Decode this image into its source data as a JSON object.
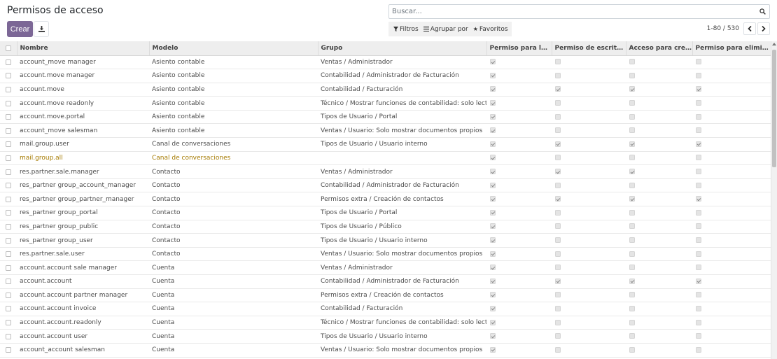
{
  "page": {
    "title": "Permisos de acceso"
  },
  "toolbar": {
    "create_label": "Crear"
  },
  "search": {
    "placeholder": "Buscar..."
  },
  "filters": {
    "filters_label": "Filtros",
    "groupby_label": "Agrupar por",
    "favorites_label": "Favoritos"
  },
  "pager": {
    "value": "1-80 / 530"
  },
  "colors": {
    "accent": "#7c6796",
    "warning_text": "#a57a00"
  },
  "icons": {
    "download": "download-icon",
    "search": "search-icon",
    "filter": "filter-icon",
    "groupby": "list-icon",
    "favorite": "star-icon",
    "prev": "chevron-left-icon",
    "next": "chevron-right-icon"
  },
  "table": {
    "columns": [
      "Nombre",
      "Modelo",
      "Grupo",
      "Permiso para leer",
      "Permiso de escritura…",
      "Acceso para crear",
      "Permiso para elimina…"
    ],
    "rows": [
      {
        "name": "account_move manager",
        "model": "Asiento contable",
        "group": "Ventas / Administrador",
        "read": true,
        "write": false,
        "create": false,
        "unlink": false
      },
      {
        "name": "account.move manager",
        "model": "Asiento contable",
        "group": "Contabilidad / Administrador de Facturación",
        "read": true,
        "write": false,
        "create": false,
        "unlink": false
      },
      {
        "name": "account.move",
        "model": "Asiento contable",
        "group": "Contabilidad / Facturación",
        "read": true,
        "write": true,
        "create": true,
        "unlink": true
      },
      {
        "name": "account.move readonly",
        "model": "Asiento contable",
        "group": "Técnico / Mostrar funciones de contabilidad: solo lectura",
        "read": true,
        "write": false,
        "create": false,
        "unlink": false
      },
      {
        "name": "account.move.portal",
        "model": "Asiento contable",
        "group": "Tipos de Usuario / Portal",
        "read": true,
        "write": false,
        "create": false,
        "unlink": false
      },
      {
        "name": "account_move salesman",
        "model": "Asiento contable",
        "group": "Ventas / Usuario: Solo mostrar documentos propios",
        "read": true,
        "write": false,
        "create": false,
        "unlink": false
      },
      {
        "name": "mail.group.user",
        "model": "Canal de conversaciones",
        "group": "Tipos de Usuario / Usuario interno",
        "read": true,
        "write": true,
        "create": true,
        "unlink": true
      },
      {
        "name": "mail.group.all",
        "model": "Canal de conversaciones",
        "group": "",
        "read": true,
        "write": false,
        "create": false,
        "unlink": false,
        "warning": true
      },
      {
        "name": "res.partner.sale.manager",
        "model": "Contacto",
        "group": "Ventas / Administrador",
        "read": true,
        "write": true,
        "create": true,
        "unlink": false
      },
      {
        "name": "res_partner group_account_manager",
        "model": "Contacto",
        "group": "Contabilidad / Administrador de Facturación",
        "read": true,
        "write": false,
        "create": false,
        "unlink": false
      },
      {
        "name": "res_partner group_partner_manager",
        "model": "Contacto",
        "group": "Permisos extra / Creación de contactos",
        "read": true,
        "write": true,
        "create": true,
        "unlink": true
      },
      {
        "name": "res_partner group_portal",
        "model": "Contacto",
        "group": "Tipos de Usuario / Portal",
        "read": true,
        "write": false,
        "create": false,
        "unlink": false
      },
      {
        "name": "res_partner group_public",
        "model": "Contacto",
        "group": "Tipos de Usuario / Público",
        "read": true,
        "write": false,
        "create": false,
        "unlink": false
      },
      {
        "name": "res_partner group_user",
        "model": "Contacto",
        "group": "Tipos de Usuario / Usuario interno",
        "read": true,
        "write": false,
        "create": false,
        "unlink": false
      },
      {
        "name": "res.partner.sale.user",
        "model": "Contacto",
        "group": "Ventas / Usuario: Solo mostrar documentos propios",
        "read": true,
        "write": false,
        "create": false,
        "unlink": false
      },
      {
        "name": "account.account sale manager",
        "model": "Cuenta",
        "group": "Ventas / Administrador",
        "read": true,
        "write": false,
        "create": false,
        "unlink": false
      },
      {
        "name": "account.account",
        "model": "Cuenta",
        "group": "Contabilidad / Administrador de Facturación",
        "read": true,
        "write": true,
        "create": true,
        "unlink": true
      },
      {
        "name": "account.account partner manager",
        "model": "Cuenta",
        "group": "Permisos extra / Creación de contactos",
        "read": true,
        "write": false,
        "create": false,
        "unlink": false
      },
      {
        "name": "account.account invoice",
        "model": "Cuenta",
        "group": "Contabilidad / Facturación",
        "read": true,
        "write": false,
        "create": false,
        "unlink": false
      },
      {
        "name": "account.account.readonly",
        "model": "Cuenta",
        "group": "Técnico / Mostrar funciones de contabilidad: solo lectura",
        "read": true,
        "write": false,
        "create": false,
        "unlink": false
      },
      {
        "name": "account.account user",
        "model": "Cuenta",
        "group": "Tipos de Usuario / Usuario interno",
        "read": true,
        "write": false,
        "create": false,
        "unlink": false
      },
      {
        "name": "account_account salesman",
        "model": "Cuenta",
        "group": "Ventas / Usuario: Solo mostrar documentos propios",
        "read": true,
        "write": false,
        "create": false,
        "unlink": false
      }
    ]
  }
}
